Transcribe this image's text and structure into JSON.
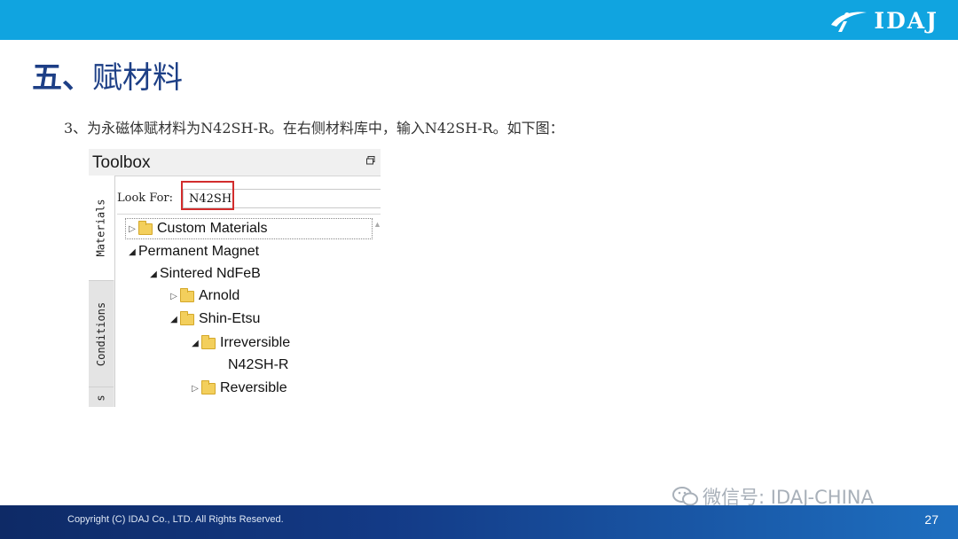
{
  "header": {
    "logo_text": "IDAJ",
    "bar_color": "#10a4e0"
  },
  "slide": {
    "title_num": "五、",
    "title_rest": "赋材料",
    "instruction": "3、为永磁体赋材料为N42SH-R。在右侧材料库中，输入N42SH-R。如下图："
  },
  "toolbox": {
    "title": "Toolbox",
    "pin_icon": "pin-icon",
    "tabs": [
      "Materials",
      "Conditions",
      "s"
    ],
    "look_for_label": "Look For:",
    "look_for_value": "N42SH",
    "tree": [
      {
        "label": "Custom Materials",
        "expanded": false,
        "folder": true
      },
      {
        "label": "Permanent Magnet",
        "expanded": true,
        "folder": false
      },
      {
        "label": "Sintered NdFeB",
        "expanded": true,
        "folder": false
      },
      {
        "label": "Arnold",
        "expanded": false,
        "folder": true
      },
      {
        "label": "Shin-Etsu",
        "expanded": true,
        "folder": true
      },
      {
        "label": "Irreversible",
        "expanded": true,
        "folder": true
      },
      {
        "label": "N42SH-R",
        "expanded": null,
        "folder": false
      },
      {
        "label": "Reversible",
        "expanded": false,
        "folder": true
      }
    ]
  },
  "watermark": {
    "text": "微信号: IDAJ-CHINA"
  },
  "footer": {
    "copyright": "Copyright (C) IDAJ Co., LTD. All Rights Reserved.",
    "page_number": "27"
  }
}
